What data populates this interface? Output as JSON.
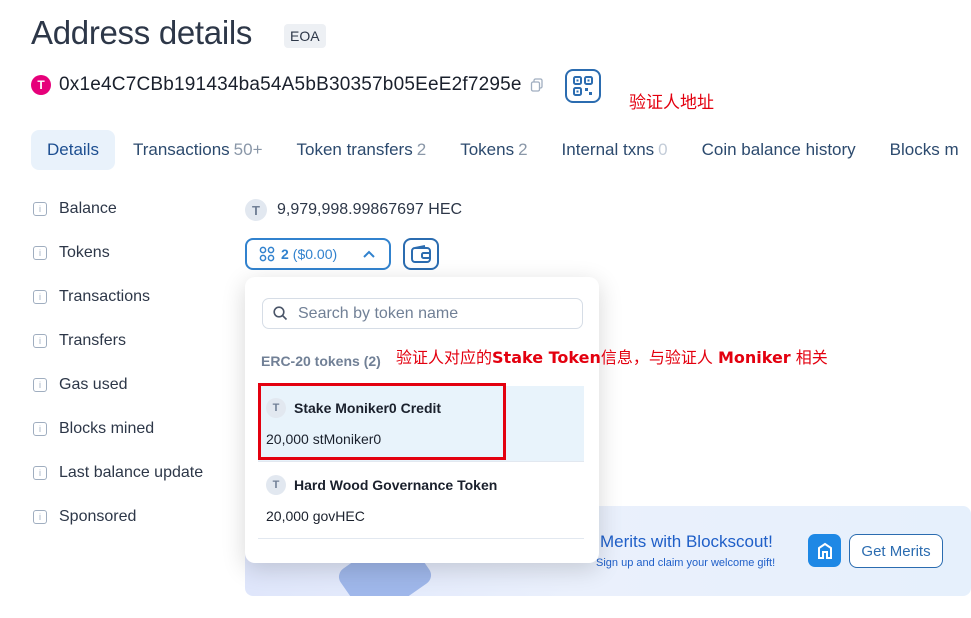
{
  "page": {
    "title": "Address details",
    "badge": "EOA",
    "address": "0x1e4C7CBb191434ba54A5bB30357b05EeE2f7295e"
  },
  "annotations": {
    "address_note": "验证人地址",
    "token_note_prefix": "验证人对应的",
    "token_note_bold1": "Stake Token",
    "token_note_mid": "信息，与验证人 ",
    "token_note_bold2": "Moniker",
    "token_note_suffix": " 相关"
  },
  "tabs": [
    {
      "label": "Details",
      "count": ""
    },
    {
      "label": "Transactions",
      "count": "50+"
    },
    {
      "label": "Token transfers",
      "count": "2"
    },
    {
      "label": "Tokens",
      "count": "2"
    },
    {
      "label": "Internal txns",
      "count": "0"
    },
    {
      "label": "Coin balance history",
      "count": ""
    },
    {
      "label": "Blocks m",
      "count": ""
    }
  ],
  "details": {
    "labels": [
      "Balance",
      "Tokens",
      "Transactions",
      "Transfers",
      "Gas used",
      "Blocks mined",
      "Last balance update",
      "Sponsored"
    ],
    "balance_icon": "T",
    "balance_value": "9,979,998.99867697 HEC",
    "tokens_count": "2",
    "tokens_value": "($0.00)"
  },
  "dropdown": {
    "search_placeholder": "Search by token name",
    "section_header": "ERC-20 tokens (2)",
    "items": [
      {
        "icon": "T",
        "name": "Stake Moniker0 Credit",
        "amount": "20,000 stMoniker0"
      },
      {
        "icon": "T",
        "name": "Hard Wood Governance Token",
        "amount": "20,000 govHEC"
      }
    ]
  },
  "promo": {
    "title": "Merits with Blockscout!",
    "subtitle": "Sign up and claim your welcome gift!",
    "button": "Get Merits"
  },
  "colors": {
    "accent": "#3182ce",
    "annotation": "#e3000f",
    "tab_active_bg": "#e9f2fb"
  }
}
